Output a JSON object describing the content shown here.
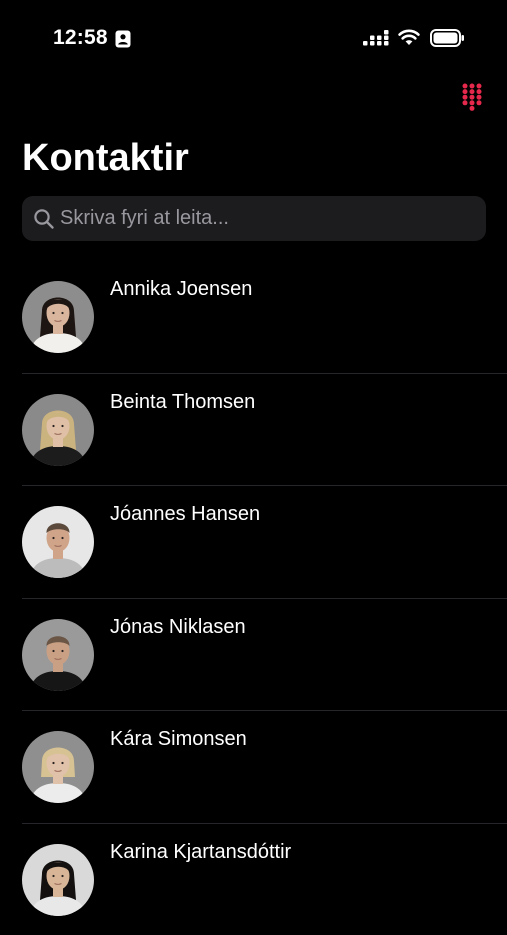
{
  "status_bar": {
    "time": "12:58"
  },
  "header": {
    "title": "Kontaktir",
    "accent_color": "#e5284b"
  },
  "search": {
    "placeholder": "Skriva fyri at leita...",
    "value": ""
  },
  "contacts": [
    {
      "name": "Annika Joensen",
      "avatar": {
        "bg": "#8d8d8d",
        "hair": "#1d1512",
        "skin": "#d8b59c",
        "shirt": "#f2f0ec",
        "hair_style": "long"
      }
    },
    {
      "name": "Beinta Thomsen",
      "avatar": {
        "bg": "#8a8a8a",
        "hair": "#cbb37f",
        "skin": "#dfbfa6",
        "shirt": "#1c1c1c",
        "hair_style": "long"
      }
    },
    {
      "name": "Jóannes Hansen",
      "avatar": {
        "bg": "#e7e7e7",
        "hair": "#5b4a3c",
        "skin": "#cfa489",
        "shirt": "#bcbcbc",
        "hair_style": "short"
      }
    },
    {
      "name": "Jónas Niklasen",
      "avatar": {
        "bg": "#9a9a9a",
        "hair": "#6b5646",
        "skin": "#caa085",
        "shirt": "#161616",
        "hair_style": "short"
      }
    },
    {
      "name": "Kára Simonsen",
      "avatar": {
        "bg": "#8f8f8f",
        "hair": "#d6c293",
        "skin": "#e0c1a9",
        "shirt": "#ececec",
        "hair_style": "bob"
      }
    },
    {
      "name": "Karina Kjartansdóttir",
      "avatar": {
        "bg": "#d9d9d9",
        "hair": "#141010",
        "skin": "#d7b596",
        "shirt": "#e8e8e8",
        "hair_style": "long"
      }
    }
  ]
}
